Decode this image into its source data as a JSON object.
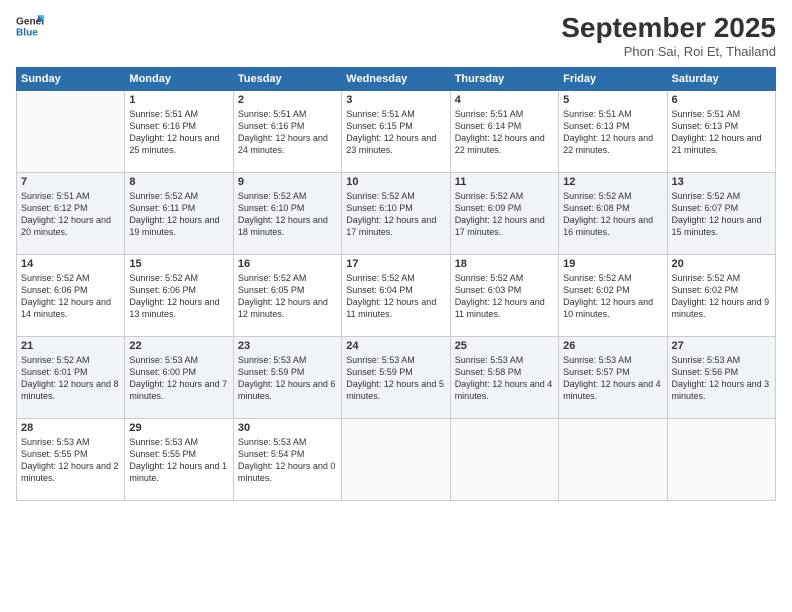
{
  "header": {
    "logo_line1": "General",
    "logo_line2": "Blue",
    "month": "September 2025",
    "location": "Phon Sai, Roi Et, Thailand"
  },
  "days_of_week": [
    "Sunday",
    "Monday",
    "Tuesday",
    "Wednesday",
    "Thursday",
    "Friday",
    "Saturday"
  ],
  "weeks": [
    [
      {
        "num": "",
        "sunrise": "",
        "sunset": "",
        "daylight": ""
      },
      {
        "num": "1",
        "sunrise": "Sunrise: 5:51 AM",
        "sunset": "Sunset: 6:16 PM",
        "daylight": "Daylight: 12 hours and 25 minutes."
      },
      {
        "num": "2",
        "sunrise": "Sunrise: 5:51 AM",
        "sunset": "Sunset: 6:16 PM",
        "daylight": "Daylight: 12 hours and 24 minutes."
      },
      {
        "num": "3",
        "sunrise": "Sunrise: 5:51 AM",
        "sunset": "Sunset: 6:15 PM",
        "daylight": "Daylight: 12 hours and 23 minutes."
      },
      {
        "num": "4",
        "sunrise": "Sunrise: 5:51 AM",
        "sunset": "Sunset: 6:14 PM",
        "daylight": "Daylight: 12 hours and 22 minutes."
      },
      {
        "num": "5",
        "sunrise": "Sunrise: 5:51 AM",
        "sunset": "Sunset: 6:13 PM",
        "daylight": "Daylight: 12 hours and 22 minutes."
      },
      {
        "num": "6",
        "sunrise": "Sunrise: 5:51 AM",
        "sunset": "Sunset: 6:13 PM",
        "daylight": "Daylight: 12 hours and 21 minutes."
      }
    ],
    [
      {
        "num": "7",
        "sunrise": "Sunrise: 5:51 AM",
        "sunset": "Sunset: 6:12 PM",
        "daylight": "Daylight: 12 hours and 20 minutes."
      },
      {
        "num": "8",
        "sunrise": "Sunrise: 5:52 AM",
        "sunset": "Sunset: 6:11 PM",
        "daylight": "Daylight: 12 hours and 19 minutes."
      },
      {
        "num": "9",
        "sunrise": "Sunrise: 5:52 AM",
        "sunset": "Sunset: 6:10 PM",
        "daylight": "Daylight: 12 hours and 18 minutes."
      },
      {
        "num": "10",
        "sunrise": "Sunrise: 5:52 AM",
        "sunset": "Sunset: 6:10 PM",
        "daylight": "Daylight: 12 hours and 17 minutes."
      },
      {
        "num": "11",
        "sunrise": "Sunrise: 5:52 AM",
        "sunset": "Sunset: 6:09 PM",
        "daylight": "Daylight: 12 hours and 17 minutes."
      },
      {
        "num": "12",
        "sunrise": "Sunrise: 5:52 AM",
        "sunset": "Sunset: 6:08 PM",
        "daylight": "Daylight: 12 hours and 16 minutes."
      },
      {
        "num": "13",
        "sunrise": "Sunrise: 5:52 AM",
        "sunset": "Sunset: 6:07 PM",
        "daylight": "Daylight: 12 hours and 15 minutes."
      }
    ],
    [
      {
        "num": "14",
        "sunrise": "Sunrise: 5:52 AM",
        "sunset": "Sunset: 6:06 PM",
        "daylight": "Daylight: 12 hours and 14 minutes."
      },
      {
        "num": "15",
        "sunrise": "Sunrise: 5:52 AM",
        "sunset": "Sunset: 6:06 PM",
        "daylight": "Daylight: 12 hours and 13 minutes."
      },
      {
        "num": "16",
        "sunrise": "Sunrise: 5:52 AM",
        "sunset": "Sunset: 6:05 PM",
        "daylight": "Daylight: 12 hours and 12 minutes."
      },
      {
        "num": "17",
        "sunrise": "Sunrise: 5:52 AM",
        "sunset": "Sunset: 6:04 PM",
        "daylight": "Daylight: 12 hours and 11 minutes."
      },
      {
        "num": "18",
        "sunrise": "Sunrise: 5:52 AM",
        "sunset": "Sunset: 6:03 PM",
        "daylight": "Daylight: 12 hours and 11 minutes."
      },
      {
        "num": "19",
        "sunrise": "Sunrise: 5:52 AM",
        "sunset": "Sunset: 6:02 PM",
        "daylight": "Daylight: 12 hours and 10 minutes."
      },
      {
        "num": "20",
        "sunrise": "Sunrise: 5:52 AM",
        "sunset": "Sunset: 6:02 PM",
        "daylight": "Daylight: 12 hours and 9 minutes."
      }
    ],
    [
      {
        "num": "21",
        "sunrise": "Sunrise: 5:52 AM",
        "sunset": "Sunset: 6:01 PM",
        "daylight": "Daylight: 12 hours and 8 minutes."
      },
      {
        "num": "22",
        "sunrise": "Sunrise: 5:53 AM",
        "sunset": "Sunset: 6:00 PM",
        "daylight": "Daylight: 12 hours and 7 minutes."
      },
      {
        "num": "23",
        "sunrise": "Sunrise: 5:53 AM",
        "sunset": "Sunset: 5:59 PM",
        "daylight": "Daylight: 12 hours and 6 minutes."
      },
      {
        "num": "24",
        "sunrise": "Sunrise: 5:53 AM",
        "sunset": "Sunset: 5:59 PM",
        "daylight": "Daylight: 12 hours and 5 minutes."
      },
      {
        "num": "25",
        "sunrise": "Sunrise: 5:53 AM",
        "sunset": "Sunset: 5:58 PM",
        "daylight": "Daylight: 12 hours and 4 minutes."
      },
      {
        "num": "26",
        "sunrise": "Sunrise: 5:53 AM",
        "sunset": "Sunset: 5:57 PM",
        "daylight": "Daylight: 12 hours and 4 minutes."
      },
      {
        "num": "27",
        "sunrise": "Sunrise: 5:53 AM",
        "sunset": "Sunset: 5:56 PM",
        "daylight": "Daylight: 12 hours and 3 minutes."
      }
    ],
    [
      {
        "num": "28",
        "sunrise": "Sunrise: 5:53 AM",
        "sunset": "Sunset: 5:55 PM",
        "daylight": "Daylight: 12 hours and 2 minutes."
      },
      {
        "num": "29",
        "sunrise": "Sunrise: 5:53 AM",
        "sunset": "Sunset: 5:55 PM",
        "daylight": "Daylight: 12 hours and 1 minute."
      },
      {
        "num": "30",
        "sunrise": "Sunrise: 5:53 AM",
        "sunset": "Sunset: 5:54 PM",
        "daylight": "Daylight: 12 hours and 0 minutes."
      },
      {
        "num": "",
        "sunrise": "",
        "sunset": "",
        "daylight": ""
      },
      {
        "num": "",
        "sunrise": "",
        "sunset": "",
        "daylight": ""
      },
      {
        "num": "",
        "sunrise": "",
        "sunset": "",
        "daylight": ""
      },
      {
        "num": "",
        "sunrise": "",
        "sunset": "",
        "daylight": ""
      }
    ]
  ]
}
